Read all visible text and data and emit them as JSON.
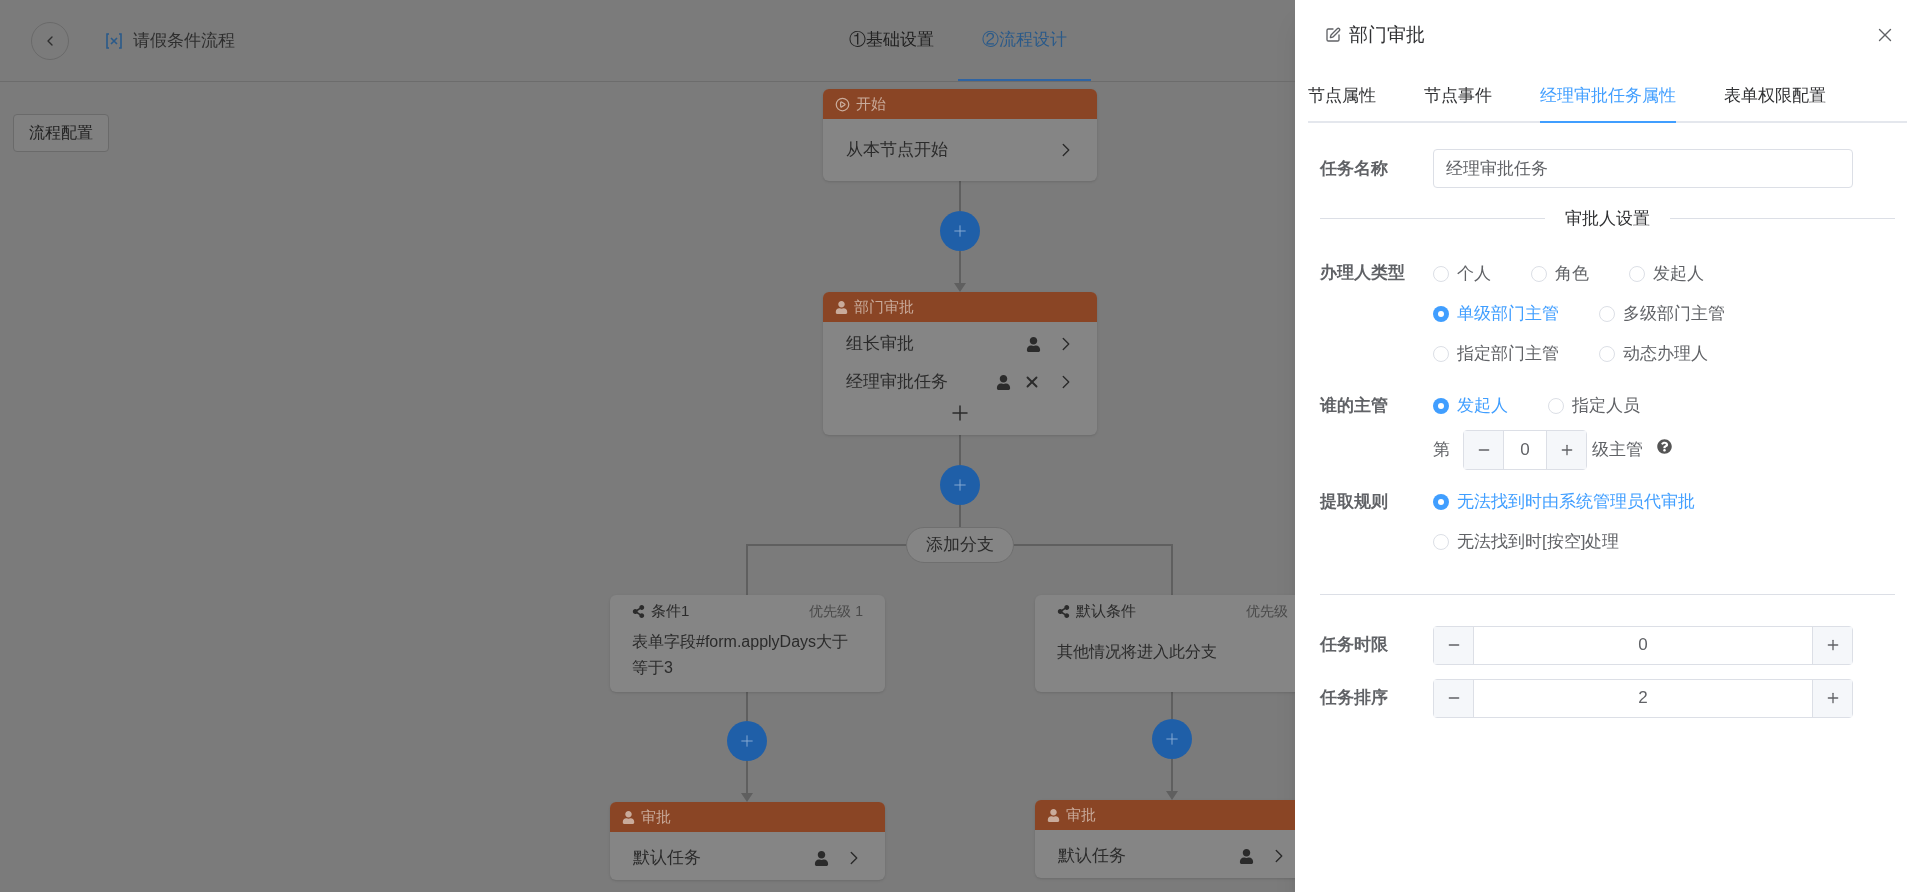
{
  "header": {
    "title": "请假条件流程",
    "steps": [
      {
        "label": "①基础设置",
        "selected": false
      },
      {
        "label": "②流程设计",
        "selected": true
      }
    ]
  },
  "toolbar": {
    "button": "流程配置"
  },
  "flow": {
    "start": {
      "title": "开始",
      "label": "从本节点开始"
    },
    "approval": {
      "title": "部门审批",
      "tasks": [
        {
          "label": "组长审批",
          "removable": false
        },
        {
          "label": "经理审批任务",
          "removable": true
        }
      ]
    },
    "branch_button": "添加分支",
    "branches": [
      {
        "condition": "条件1",
        "priority": "优先级 1",
        "text": "表单字段#form.applyDays大于等于3",
        "node": {
          "title": "审批",
          "tasks": [
            {
              "label": "默认任务",
              "removable": false
            }
          ]
        }
      },
      {
        "condition": "默认条件",
        "priority": "优先级",
        "text": "其他情况将进入此分支",
        "node": {
          "title": "审批",
          "tasks": [
            {
              "label": "默认任务",
              "removable": false
            }
          ]
        }
      }
    ]
  },
  "drawer": {
    "title": "部门审批",
    "tabs": [
      {
        "label": "节点属性",
        "selected": false
      },
      {
        "label": "节点事件",
        "selected": false
      },
      {
        "label": "经理审批任务属性",
        "selected": true
      },
      {
        "label": "表单权限配置",
        "selected": false
      }
    ],
    "task_name": {
      "label": "任务名称",
      "value": "经理审批任务"
    },
    "section": "审批人设置",
    "assignee_type": {
      "label": "办理人类型",
      "options": [
        {
          "label": "个人",
          "selected": false
        },
        {
          "label": "角色",
          "selected": false
        },
        {
          "label": "发起人",
          "selected": false
        },
        {
          "label": "单级部门主管",
          "selected": true
        },
        {
          "label": "多级部门主管",
          "selected": false
        },
        {
          "label": "指定部门主管",
          "selected": false
        },
        {
          "label": "动态办理人",
          "selected": false
        }
      ]
    },
    "whose_manager": {
      "label": "谁的主管",
      "options": [
        {
          "label": "发起人",
          "selected": true
        },
        {
          "label": "指定人员",
          "selected": false
        }
      ],
      "level": {
        "prefix": "第",
        "value": "0",
        "suffix": "级主管"
      }
    },
    "rule": {
      "label": "提取规则",
      "options": [
        {
          "label": "无法找到时由系统管理员代审批",
          "selected": true
        },
        {
          "label": "无法找到时[按空]处理",
          "selected": false
        }
      ]
    },
    "numbers": [
      {
        "label": "任务时限",
        "value": "0"
      },
      {
        "label": "任务排序",
        "value": "2"
      }
    ]
  }
}
